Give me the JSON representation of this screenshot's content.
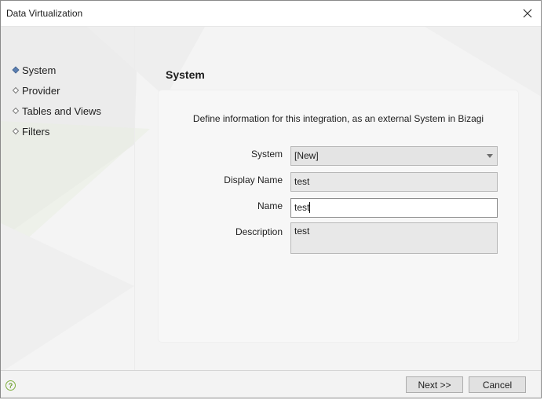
{
  "window": {
    "title": "Data Virtualization",
    "close_icon": "close-icon"
  },
  "nav": {
    "items": [
      {
        "label": "System",
        "active": true
      },
      {
        "label": "Provider",
        "active": false
      },
      {
        "label": "Tables and Views",
        "active": false
      },
      {
        "label": "Filters",
        "active": false
      }
    ]
  },
  "content": {
    "section_title": "System",
    "intro": "Define information for this integration, as an external System in Bizagi",
    "fields": {
      "system": {
        "label": "System",
        "value": "[New]"
      },
      "display_name": {
        "label": "Display Name",
        "value": "test"
      },
      "name": {
        "label": "Name",
        "value": "test"
      },
      "description": {
        "label": "Description",
        "value": "test"
      }
    }
  },
  "footer": {
    "help_icon": "help-icon",
    "next_label": "Next >>",
    "cancel_label": "Cancel"
  },
  "colors": {
    "active_bullet": "#5b7fb0",
    "inactive_bullet": "#9a9a9a",
    "help_green": "#7fae3f"
  }
}
